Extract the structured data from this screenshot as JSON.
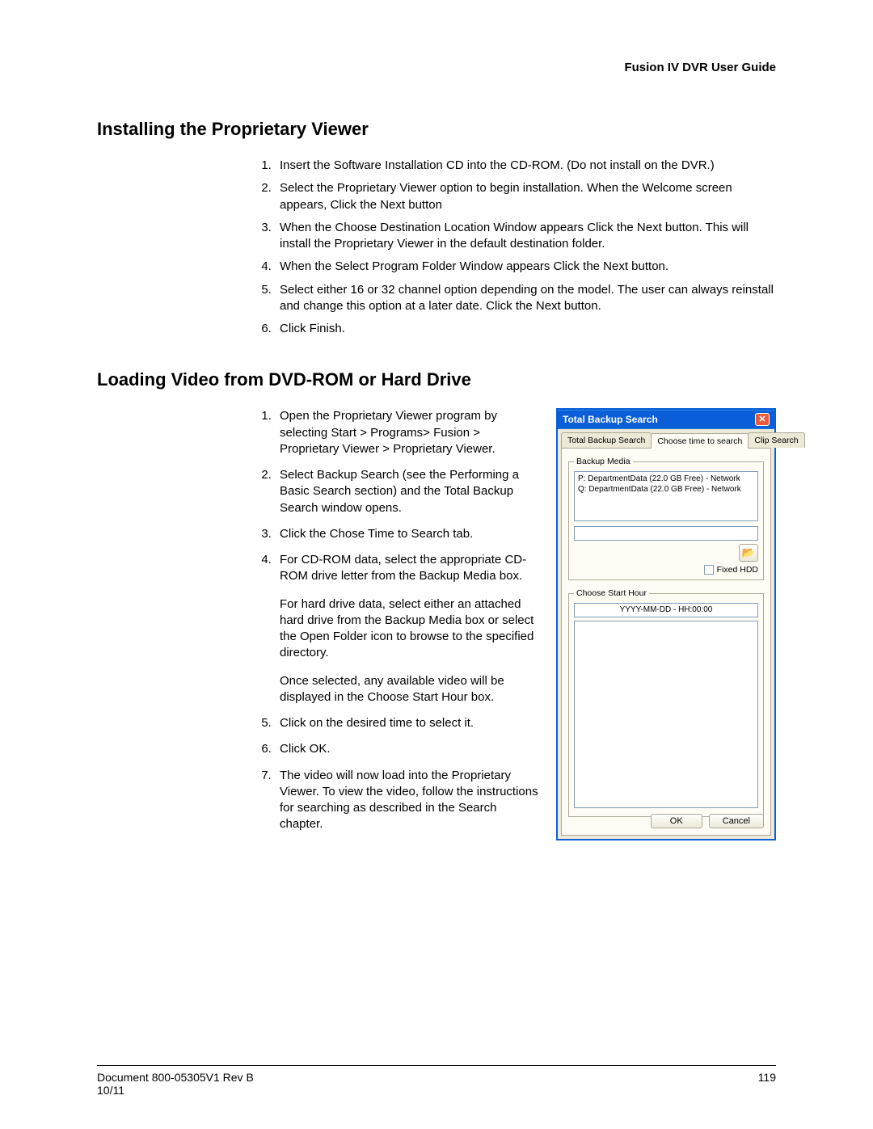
{
  "header": {
    "guide_title": "Fusion IV DVR User Guide"
  },
  "section1": {
    "heading": "Installing the Proprietary Viewer",
    "steps": [
      "Insert the Software Installation CD into the CD-ROM.  (Do not install on the DVR.)",
      "Select the Proprietary Viewer option to begin installation.  When the Welcome screen appears, Click the Next button",
      "When the Choose Destination Location Window appears Click the Next button.  This will install the Proprietary Viewer in the default destination folder.",
      "When the Select Program Folder Window appears Click the Next button.",
      "Select either 16 or 32 channel option depending on the model.  The user can always reinstall and change this option at a later date. Click the Next button.",
      "Click Finish."
    ]
  },
  "section2": {
    "heading": "Loading Video from DVD-ROM or Hard Drive",
    "steps": {
      "s1": "Open the Proprietary Viewer program by selecting Start > Programs> Fusion > Proprietary Viewer > Proprietary Viewer.",
      "s2": "Select Backup Search (see the Performing a Basic Search section) and the Total Backup Search window opens.",
      "s3": "Click the Chose Time to Search tab.",
      "s4a": "For CD-ROM data, select the appropriate CD-ROM drive letter from the Backup Media box.",
      "s4b": "For hard drive data, select either an attached hard drive from the Backup Media box or select the Open Folder icon to browse to the specified directory.",
      "s4c": "Once selected, any available video will be displayed in the Choose Start Hour box.",
      "s5": "Click on the desired time to select it.",
      "s6": "Click OK.",
      "s7": "The video will now load into the Proprietary Viewer. To view the video, follow the instructions for searching as described in the Search chapter."
    }
  },
  "dialog": {
    "title": "Total Backup Search",
    "tabs": {
      "t1": "Total Backup Search",
      "t2": "Choose time to search",
      "t3": "Clip Search"
    },
    "group1_label": "Backup Media",
    "media_items": {
      "p": "P:  DepartmentData (22.0 GB Free) - Network",
      "q": "Q:  DepartmentData (22.0 GB Free) - Network"
    },
    "fixed_hdd_label": "Fixed HDD",
    "folder_icon": "📂",
    "group2_label": "Choose Start Hour",
    "time_placeholder": "YYYY-MM-DD - HH:00:00",
    "ok_label": "OK",
    "cancel_label": "Cancel"
  },
  "footer": {
    "doc_ref": "Document 800-05305V1 Rev B",
    "date": "10/11",
    "page_no": "119"
  }
}
